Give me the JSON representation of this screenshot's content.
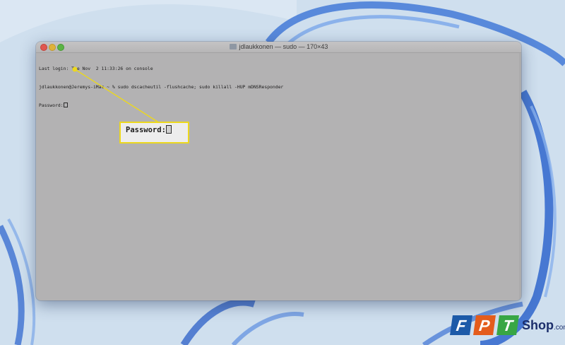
{
  "window": {
    "title": "jdlaukkonen — sudo — 170×43"
  },
  "terminal": {
    "lines": [
      "Last login: Tue Nov  2 11:33:26 on console",
      "jdlaukkonen@Jeremys-iMac ~ % sudo dscacheutil -flushcache; sudo killall -HUP mDNSResponder",
      "Password:"
    ]
  },
  "callout": {
    "text": "Password:"
  },
  "branding": {
    "logo_letters": [
      "F",
      "P",
      "T"
    ],
    "logo_word": "Shop",
    "logo_domain": ".com.vn"
  },
  "colors": {
    "highlight": "#ecd81e",
    "logo_blue": "#1d5aa8",
    "logo_orange": "#e45c1c",
    "logo_green": "#38a644"
  },
  "icons": [
    "folder-icon",
    "cursor-block-icon"
  ]
}
